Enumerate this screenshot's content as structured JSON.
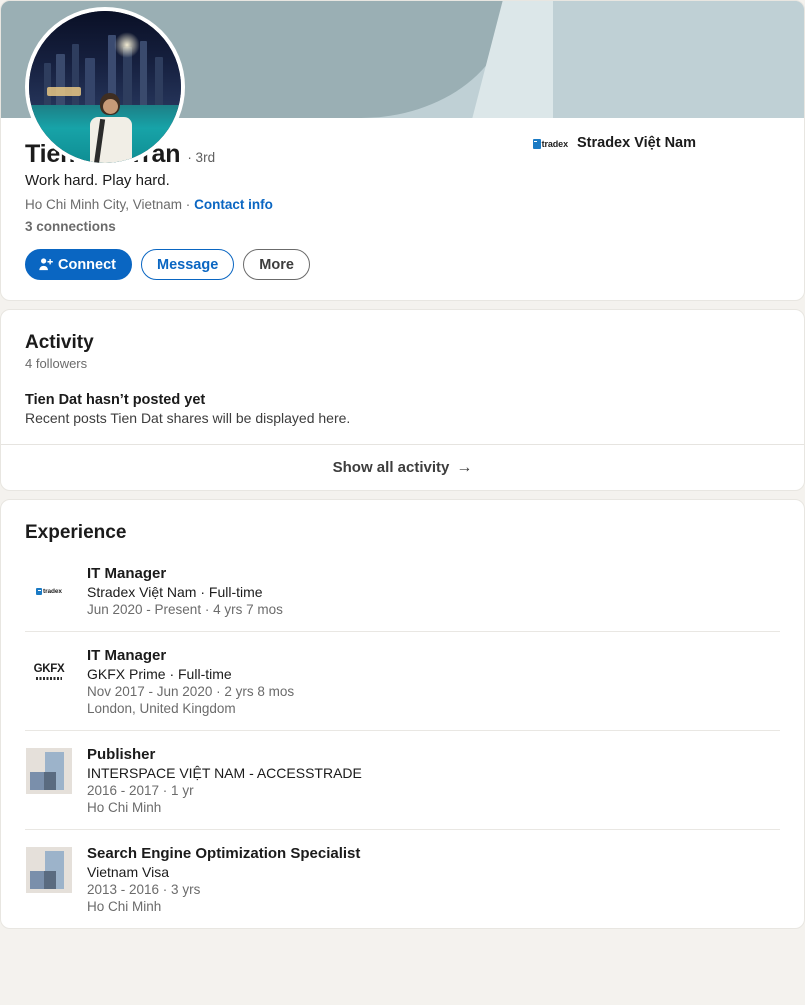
{
  "profile": {
    "name": "Tien Dat Tran",
    "degree": "· 3rd",
    "headline": "Work hard. Play hard.",
    "location": "Ho Chi Minh City, Vietnam ·",
    "contact_info": "Contact info",
    "connections": "3 connections",
    "avatar_alt": "profile-photo",
    "buttons": {
      "connect": "Connect",
      "message": "Message",
      "more": "More"
    },
    "current_company": {
      "name": "Stradex Việt Nam",
      "logo_text": "tradex"
    }
  },
  "activity": {
    "title": "Activity",
    "followers": "4 followers",
    "empty_title": "Tien Dat hasn’t posted yet",
    "empty_desc": "Recent posts Tien Dat shares will be displayed here.",
    "show_all": "Show all activity",
    "arrow": "→"
  },
  "experience": {
    "title": "Experience",
    "items": [
      {
        "title": "IT Manager",
        "company": "Stradex Việt Nam · Full-time",
        "dates": "Jun 2020 - Present · 4 yrs 7 mos",
        "location": "",
        "logo": "stradex-logo",
        "logo_text": "tradex"
      },
      {
        "title": "IT Manager",
        "company": "GKFX Prime · Full-time",
        "dates": "Nov 2017 - Jun 2020 · 2 yrs 8 mos",
        "location": "London, United Kingdom",
        "logo": "gkfx-logo",
        "logo_text": "GKFX"
      },
      {
        "title": "Publisher",
        "company": "INTERSPACE VIỆT NAM - ACCESSTRADE",
        "dates": "2016 - 2017 · 1 yr",
        "location": "Ho Chi Minh",
        "logo": "placeholder-logo",
        "logo_text": ""
      },
      {
        "title": "Search Engine Optimization Specialist",
        "company": "Vietnam Visa",
        "dates": "2013 - 2016 · 3 yrs",
        "location": "Ho Chi Minh",
        "logo": "placeholder-logo",
        "logo_text": ""
      }
    ]
  },
  "colors": {
    "accent": "#0a66c2",
    "page_bg": "#f4f2ee",
    "card_bg": "#ffffff",
    "banner_dark": "#9aafb4",
    "banner_pale": "#dce7e9",
    "banner_light": "#bfd0d5"
  }
}
